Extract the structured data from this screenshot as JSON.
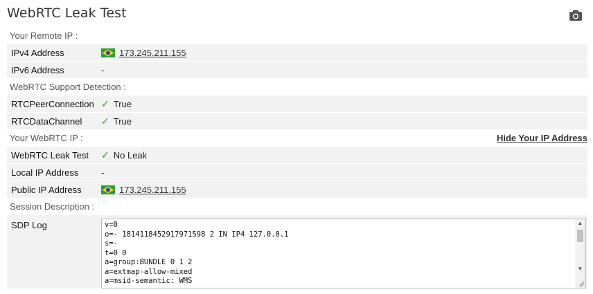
{
  "title": "WebRTC Leak Test",
  "camera_icon": "camera-icon",
  "sections": {
    "remote": {
      "heading": "Your Remote IP :",
      "ipv4_label": "IPv4 Address",
      "ipv4_value": "173.245.211.155",
      "ipv6_label": "IPv6 Address",
      "ipv6_value": "-"
    },
    "support": {
      "heading": "WebRTC Support Detection :",
      "peer_label": "RTCPeerConnection",
      "peer_value": "True",
      "channel_label": "RTCDataChannel",
      "channel_value": "True"
    },
    "webrtc_ip": {
      "heading": "Your WebRTC IP :",
      "hide_link": "Hide Your IP Address",
      "leak_label": "WebRTC Leak Test",
      "leak_value": "No Leak",
      "local_label": "Local IP Address",
      "local_value": "-",
      "public_label": "Public IP Address",
      "public_value": "173.245.211.155"
    },
    "session": {
      "heading": "Session Description :",
      "sdp_label": "SDP Log",
      "sdp_log": "v=0\no=- 1814118452917971598 2 IN IP4 127.0.0.1\ns=-\nt=0 0\na=group:BUNDLE 0 1 2\na=extmap-allow-mixed\na=msid-semantic: WMS"
    }
  },
  "check_glyph": "✓",
  "flag_icon": "brazil-flag-icon",
  "colors": {
    "row_bg": "#f2f2f2",
    "check": "#2a9d2a"
  }
}
